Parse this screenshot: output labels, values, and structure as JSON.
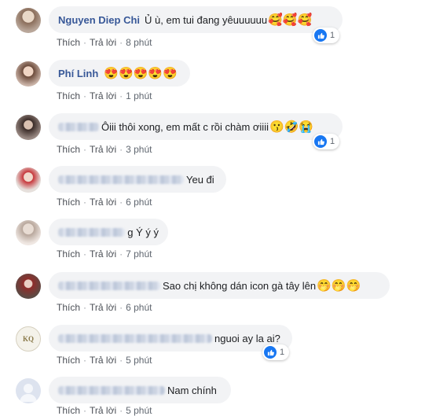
{
  "labels": {
    "like": "Thích",
    "reply": "Trả lời",
    "sep": "·"
  },
  "comments": [
    {
      "name": "Nguyen Diep Chi",
      "text": "Ủ ù, em tui đang yêuuuuuu",
      "emoji": "🥰🥰🥰",
      "time": "8 phút",
      "likes": "1"
    },
    {
      "name": "Phí Linh",
      "text": "",
      "emoji": "😍😍😍😍😍",
      "time": "1 phút"
    },
    {
      "name": "",
      "text": "Ôiii thôi xong, em mất c rồi chàm ơiiii",
      "emoji": "😗🤣😭",
      "time": "3 phút",
      "likes": "1"
    },
    {
      "name": "",
      "text": "Yeu đi",
      "emoji": "",
      "time": "6 phút"
    },
    {
      "name": "",
      "text": "g Ý ý ý",
      "emoji": "",
      "time": "7 phút"
    },
    {
      "name": "",
      "text": "Sao chị không dán icon gà tây lên",
      "emoji": "🤭🤭🤭",
      "time": "6 phút"
    },
    {
      "name": "",
      "text": "nguoi ay la ai?",
      "emoji": "",
      "time": "5 phút",
      "likes": "1"
    },
    {
      "name": "",
      "text": "Nam chính",
      "emoji": "",
      "time": "5 phút"
    }
  ],
  "avatars": {
    "4": {
      "monogram": "KQ"
    }
  }
}
